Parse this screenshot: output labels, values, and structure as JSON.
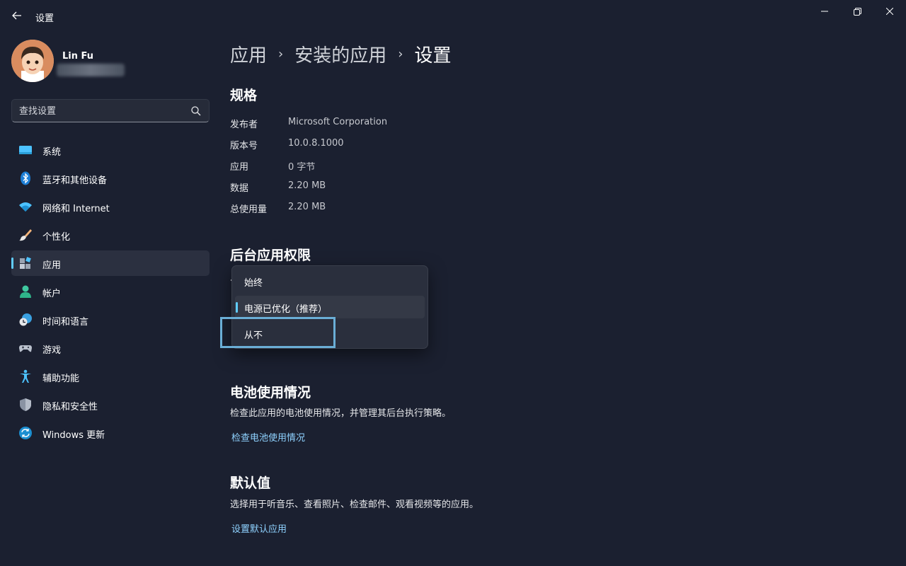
{
  "window": {
    "title": "设置",
    "back_icon": "back-arrow-icon"
  },
  "profile": {
    "name": "Lin Fu"
  },
  "search": {
    "placeholder": "查找设置"
  },
  "sidebar": {
    "items": [
      {
        "label": "系统",
        "icon": "system-icon"
      },
      {
        "label": "蓝牙和其他设备",
        "icon": "bluetooth-icon"
      },
      {
        "label": "网络和 Internet",
        "icon": "wifi-icon"
      },
      {
        "label": "个性化",
        "icon": "brush-icon"
      },
      {
        "label": "应用",
        "icon": "apps-icon",
        "active": true
      },
      {
        "label": "帐户",
        "icon": "account-icon"
      },
      {
        "label": "时间和语言",
        "icon": "time-language-icon"
      },
      {
        "label": "游戏",
        "icon": "gamepad-icon"
      },
      {
        "label": "辅助功能",
        "icon": "accessibility-icon"
      },
      {
        "label": "隐私和安全性",
        "icon": "shield-icon"
      },
      {
        "label": "Windows 更新",
        "icon": "update-icon"
      }
    ]
  },
  "breadcrumb": {
    "level1": "应用",
    "level2": "安装的应用",
    "current": "设置",
    "separator": "›"
  },
  "specs": {
    "title": "规格",
    "rows": [
      {
        "key": "发布者",
        "value": "Microsoft Corporation"
      },
      {
        "key": "版本号",
        "value": "10.0.8.1000"
      },
      {
        "key": "应用",
        "value": "0 字节"
      },
      {
        "key": "数据",
        "value": "2.20 MB"
      },
      {
        "key": "总使用量",
        "value": "2.20 MB"
      }
    ]
  },
  "background": {
    "title": "后台应用权限",
    "options": [
      "始终",
      "电源已优化（推荐）",
      "从不"
    ],
    "selected": "电源已优化（推荐）"
  },
  "battery": {
    "title": "电池使用情况",
    "description": "检查此应用的电池使用情况，并管理其后台执行策略。",
    "link": "检查电池使用情况"
  },
  "defaults": {
    "title": "默认值",
    "description": "选择用于听音乐、查看照片、检查邮件、观看视频等的应用。",
    "link": "设置默认应用"
  },
  "colors": {
    "accent": "#60cdff",
    "link": "#8fd2ff",
    "background": "#1b2030"
  }
}
